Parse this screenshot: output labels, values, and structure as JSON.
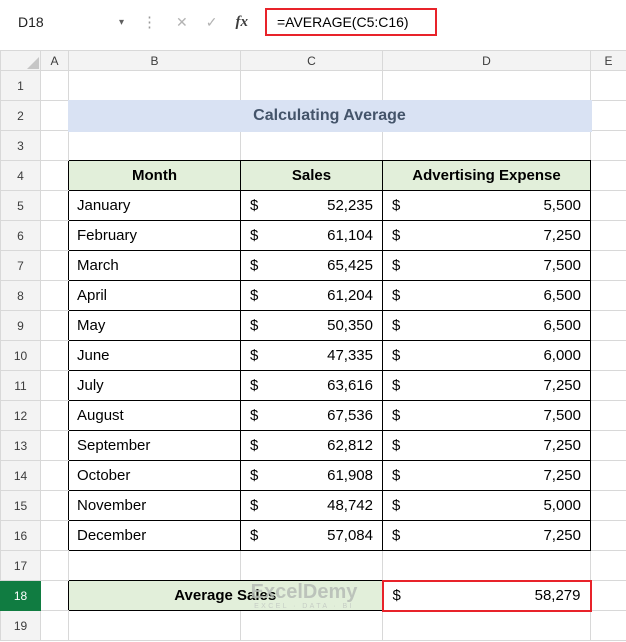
{
  "formula_bar": {
    "cell_reference": "D18",
    "formula": "=AVERAGE(C5:C16)",
    "fx_label": "fx"
  },
  "icons": {
    "chevron_down": "▾",
    "more_options": "⋮",
    "cancel": "✕",
    "enter": "✓"
  },
  "grid": {
    "column_headers": [
      "A",
      "B",
      "C",
      "D",
      "E"
    ],
    "row_headers": [
      "1",
      "2",
      "3",
      "4",
      "5",
      "6",
      "7",
      "8",
      "9",
      "10",
      "11",
      "12",
      "13",
      "14",
      "15",
      "16",
      "17",
      "18",
      "19"
    ],
    "selected_cell": "D18",
    "selected_column": "D",
    "selected_row": "18"
  },
  "title": "Calculating Average",
  "table": {
    "headers": {
      "month": "Month",
      "sales": "Sales",
      "expense": "Advertising Expense"
    },
    "currency_symbol": "$",
    "rows": [
      {
        "month": "January",
        "sales": "52,235",
        "expense": "5,500"
      },
      {
        "month": "February",
        "sales": "61,104",
        "expense": "7,250"
      },
      {
        "month": "March",
        "sales": "65,425",
        "expense": "7,500"
      },
      {
        "month": "April",
        "sales": "61,204",
        "expense": "6,500"
      },
      {
        "month": "May",
        "sales": "50,350",
        "expense": "6,500"
      },
      {
        "month": "June",
        "sales": "47,335",
        "expense": "6,000"
      },
      {
        "month": "July",
        "sales": "63,616",
        "expense": "7,250"
      },
      {
        "month": "August",
        "sales": "67,536",
        "expense": "7,500"
      },
      {
        "month": "September",
        "sales": "62,812",
        "expense": "7,250"
      },
      {
        "month": "October",
        "sales": "61,908",
        "expense": "7,250"
      },
      {
        "month": "November",
        "sales": "48,742",
        "expense": "5,000"
      },
      {
        "month": "December",
        "sales": "57,084",
        "expense": "7,250"
      }
    ]
  },
  "summary": {
    "label": "Average Sales",
    "currency_symbol": "$",
    "value": "58,279"
  },
  "watermark": {
    "brand": "ExcelDemy",
    "tagline": "EXCEL · DATA · BI"
  },
  "colors": {
    "annotation_red": "#e8232a",
    "table_header_green": "#e2efda",
    "title_background": "#d9e2f3",
    "title_text": "#44546a",
    "selection_green": "#107c41"
  }
}
